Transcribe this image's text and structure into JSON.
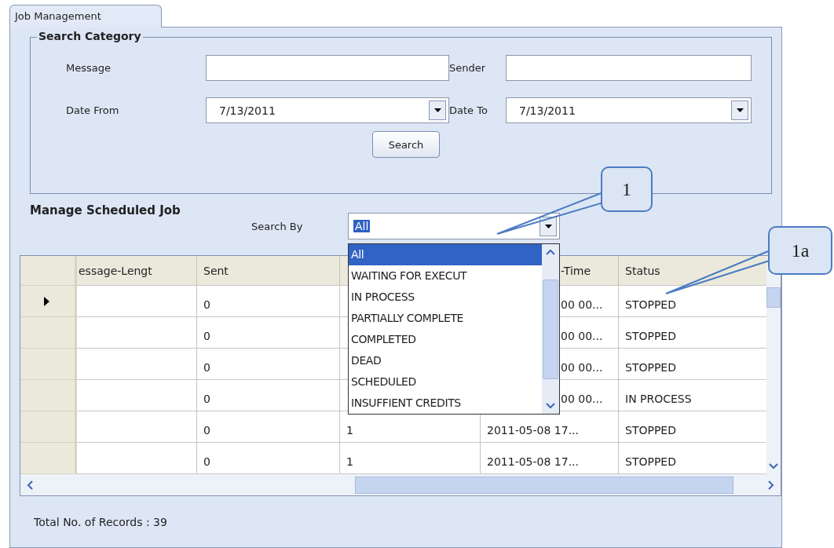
{
  "tab": {
    "label": "Job Management",
    "selected": true
  },
  "search_category": {
    "title": "Search Category",
    "fields": [
      {
        "kind": "text",
        "label": "Message"
      },
      {
        "kind": "text",
        "label": "Sender"
      },
      {
        "kind": "date",
        "label": "Date From",
        "value": "7/13/2011"
      },
      {
        "kind": "date",
        "label": "Date To",
        "value": "7/13/2011"
      }
    ],
    "button": "Search"
  },
  "manage": {
    "title": "Manage Scheduled Job",
    "search_by": {
      "label": "Search By",
      "value": "All",
      "expanded": true,
      "options": [
        {
          "label": "All",
          "selected": true
        },
        {
          "label": "WAITING FOR EXECUT",
          "selected": false
        },
        {
          "label": "IN PROCESS",
          "selected": false
        },
        {
          "label": "PARTIALLY COMPLETE",
          "selected": false
        },
        {
          "label": "COMPLETED",
          "selected": false
        },
        {
          "label": "DEAD",
          "selected": false
        },
        {
          "label": "SCHEDULED",
          "selected": false
        },
        {
          "label": "INSUFFIENT CREDITS",
          "selected": false
        }
      ]
    }
  },
  "table": {
    "columns": [
      {
        "label": "essage-Lengt"
      },
      {
        "label": "Sent"
      },
      null,
      {
        "label": "-Time",
        "covered": true
      },
      {
        "label": "Status"
      }
    ],
    "rows": [
      {
        "current": true,
        "cells": [
          null,
          "0",
          null,
          {
            "text": "00 00...",
            "covered": true
          },
          "STOPPED"
        ]
      },
      {
        "current": false,
        "cells": [
          null,
          "0",
          null,
          {
            "text": "00 00...",
            "covered": true
          },
          "STOPPED"
        ]
      },
      {
        "current": false,
        "cells": [
          null,
          "0",
          null,
          {
            "text": "00 00...",
            "covered": true
          },
          "STOPPED"
        ]
      },
      {
        "current": false,
        "cells": [
          null,
          "0",
          null,
          {
            "text": "00 00...",
            "covered": true
          },
          "IN PROCESS"
        ]
      },
      {
        "current": false,
        "cells": [
          null,
          "0",
          "1",
          "2011-05-08 17...",
          "STOPPED"
        ]
      },
      {
        "current": false,
        "cells": [
          null,
          "0",
          "1",
          "2011-05-08 17...",
          "STOPPED"
        ]
      }
    ]
  },
  "total": "Total No. of Records : 39",
  "callouts": [
    {
      "label": "1"
    },
    {
      "label": "1a"
    }
  ]
}
